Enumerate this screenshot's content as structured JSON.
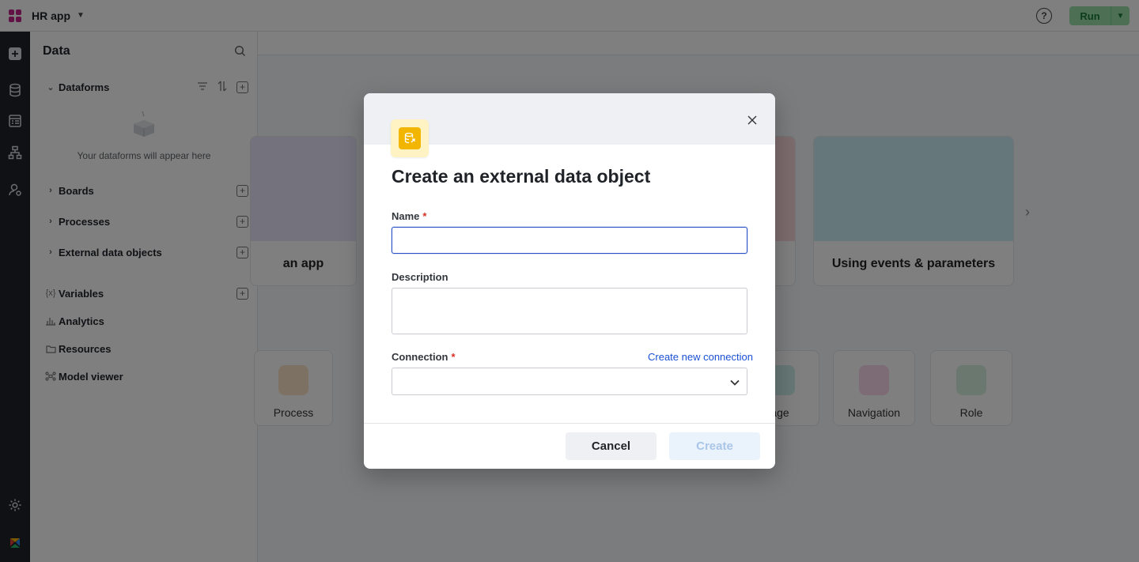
{
  "app": {
    "name": "HR app"
  },
  "topbar": {
    "help_icon": "help-circle-icon",
    "run_label": "Run"
  },
  "colors": {
    "accent": "#2b4fc7",
    "link": "#1a50d4",
    "required": "#d93025",
    "run_bg": "#9be0a9",
    "create_icon_bg": "#f2b600"
  },
  "data_panel": {
    "title": "Data",
    "sections": [
      {
        "label": "Dataforms",
        "expanded": true
      },
      {
        "label": "Boards",
        "expanded": false
      },
      {
        "label": "Processes",
        "expanded": false
      },
      {
        "label": "External data objects",
        "expanded": false
      }
    ],
    "empty_message": "Your dataforms will appear here",
    "extra": [
      {
        "label": "Variables",
        "icon": "variable-icon"
      },
      {
        "label": "Analytics",
        "icon": "analytics-icon"
      },
      {
        "label": "Resources",
        "icon": "folder-icon"
      },
      {
        "label": "Model viewer",
        "icon": "model-icon"
      }
    ]
  },
  "background": {
    "card_labels": [
      "an app",
      "Using events & parameters"
    ],
    "tiles": [
      "Process",
      "age",
      "Navigation",
      "Role"
    ]
  },
  "modal": {
    "title": "Create an external data object",
    "name_label": "Name",
    "name_value": "",
    "description_label": "Description",
    "description_value": "",
    "connection_label": "Connection",
    "connection_value": "",
    "create_connection_link": "Create new connection",
    "required_mark": "*",
    "cancel_label": "Cancel",
    "create_label": "Create"
  }
}
